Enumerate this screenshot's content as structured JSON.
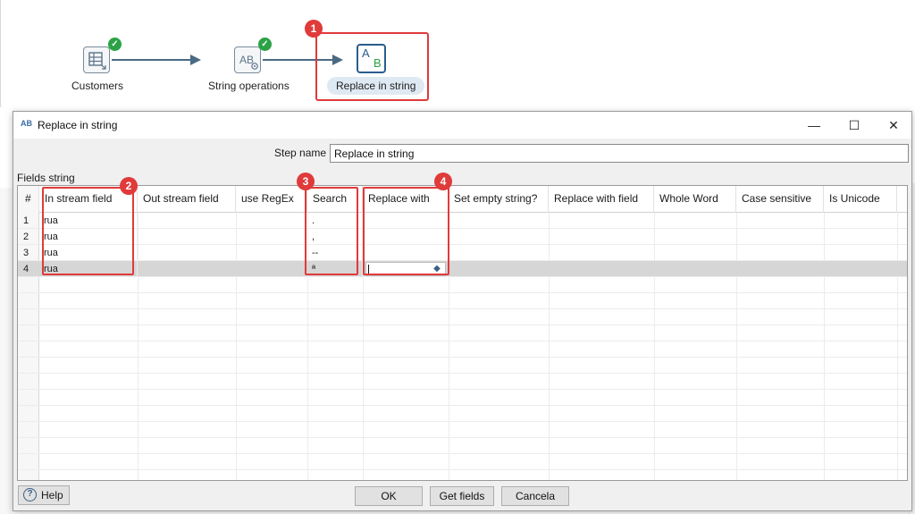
{
  "workflow": {
    "nodes": [
      {
        "label": "Customers",
        "status": "ok",
        "icon": "table-input-icon"
      },
      {
        "label": "String operations",
        "status": "ok",
        "icon": "string-ops-icon"
      },
      {
        "label": "Replace in string",
        "status": "selected",
        "icon": "replace-string-icon",
        "glyph_a": "A",
        "glyph_b": "B"
      }
    ],
    "check_glyph": "✓"
  },
  "callouts": [
    "1",
    "2",
    "3",
    "4"
  ],
  "dialog": {
    "title": "Replace in string",
    "title_icon": "AB",
    "minimize": "—",
    "maximize": "☐",
    "close": "✕",
    "step_name_label": "Step name",
    "step_name_value": "Replace in string",
    "fields_label": "Fields string",
    "columns": [
      "#",
      "In stream field",
      "Out stream field",
      "use RegEx",
      "Search",
      "Replace with",
      "Set empty string?",
      "Replace with field",
      "Whole Word",
      "Case sensitive",
      "Is Unicode"
    ],
    "rows": [
      {
        "num": "1",
        "in_stream": "rua",
        "search": "."
      },
      {
        "num": "2",
        "in_stream": "rua",
        "search": ","
      },
      {
        "num": "3",
        "in_stream": "rua",
        "search": "--"
      },
      {
        "num": "4",
        "in_stream": "rua",
        "search": "ª"
      }
    ],
    "buttons": {
      "help": "Help",
      "ok": "OK",
      "get_fields": "Get fields",
      "cancel": "Cancela"
    },
    "help_glyph": "?"
  },
  "colors": {
    "accent": "#e03a3a",
    "ok": "#2aa245",
    "selection": "#d6d6d6",
    "hop": "#4a6a84"
  }
}
